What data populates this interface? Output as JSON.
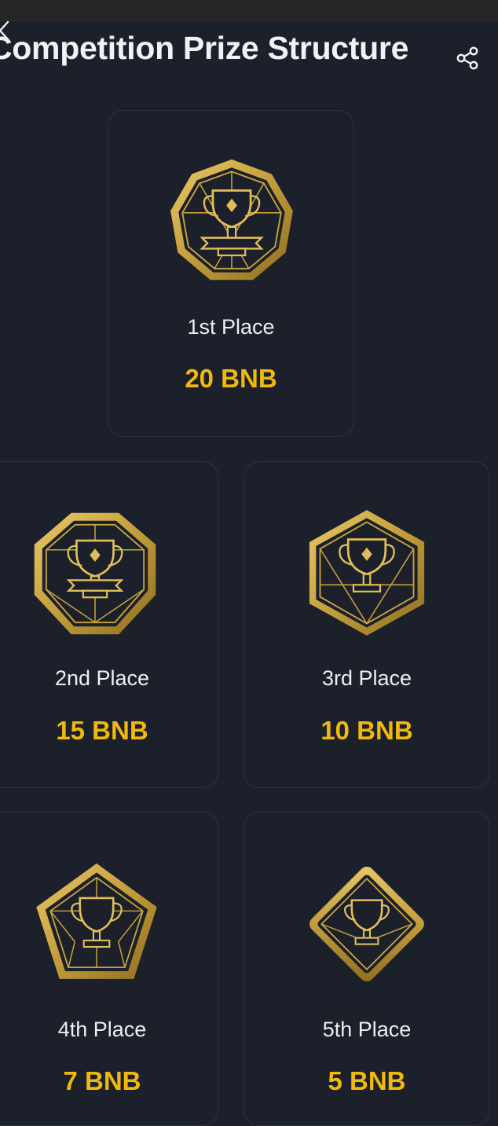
{
  "header": {
    "title": "Competition Prize Structure",
    "back_icon": "chevron-left-icon",
    "share_icon": "share-icon"
  },
  "colors": {
    "background": "#1c202b",
    "prize_gold": "#f0b90b",
    "badge_gold": "#c9a43a",
    "card_border": "#2d3240"
  },
  "prizes": [
    {
      "place": "1st Place",
      "amount": "20 BNB",
      "badge_icon": "nonagon-trophy-badge-icon"
    },
    {
      "place": "2nd Place",
      "amount": "15 BNB",
      "badge_icon": "octagon-trophy-badge-icon"
    },
    {
      "place": "3rd Place",
      "amount": "10 BNB",
      "badge_icon": "hexagon-trophy-badge-icon"
    },
    {
      "place": "4th Place",
      "amount": "7 BNB",
      "badge_icon": "pentagon-trophy-badge-icon"
    },
    {
      "place": "5th Place",
      "amount": "5 BNB",
      "badge_icon": "diamond-trophy-badge-icon"
    }
  ]
}
